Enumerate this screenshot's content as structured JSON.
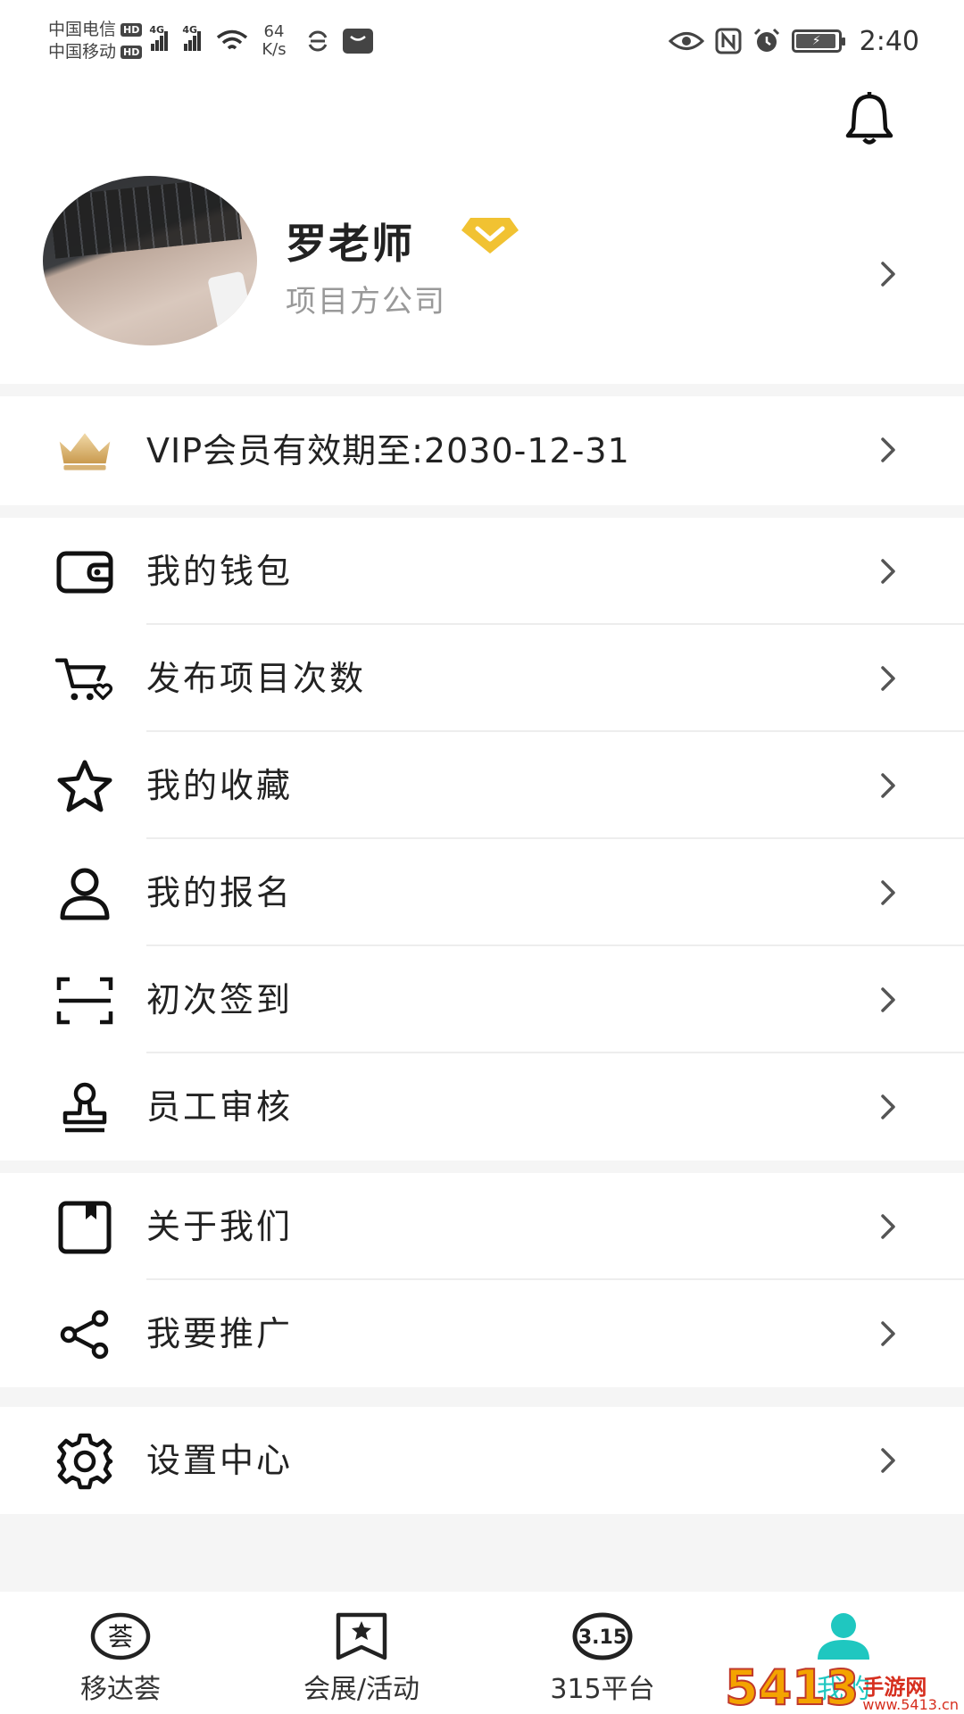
{
  "status_bar": {
    "carrier_1": "中国电信",
    "carrier_2": "中国移动",
    "hd_label": "HD",
    "network_type": "4G",
    "speed_value": "64",
    "speed_unit": "K/s",
    "time": "2:40",
    "icons": [
      "signal-icon",
      "wifi-icon",
      "sync-icon",
      "message-icon",
      "eye-icon",
      "nfc-icon",
      "alarm-icon",
      "battery-icon"
    ]
  },
  "profile": {
    "name": "罗老师",
    "company": "项目方公司",
    "badge_color": "#f1c232"
  },
  "vip": {
    "label": "VIP会员有效期至:2030-12-31"
  },
  "menu_group_1": [
    {
      "label": "我的钱包",
      "icon": "wallet-icon"
    },
    {
      "label": "发布项目次数",
      "icon": "cart-icon"
    },
    {
      "label": "我的收藏",
      "icon": "star-icon"
    },
    {
      "label": "我的报名",
      "icon": "person-icon"
    },
    {
      "label": "初次签到",
      "icon": "scan-icon"
    },
    {
      "label": "员工审核",
      "icon": "stamp-icon"
    }
  ],
  "menu_group_2": [
    {
      "label": "关于我们",
      "icon": "about-icon"
    },
    {
      "label": "我要推广",
      "icon": "share-icon"
    }
  ],
  "menu_group_3": [
    {
      "label": "设置中心",
      "icon": "gear-icon"
    }
  ],
  "tabbar": {
    "tabs": [
      {
        "label": "移达荟",
        "icon": "home-logo-icon"
      },
      {
        "label": "会展/活动",
        "icon": "bookmark-star-icon"
      },
      {
        "label": "315平台",
        "icon": "315-icon",
        "icon_text": "3.15"
      },
      {
        "label": "我的",
        "icon": "user-icon",
        "active": true
      }
    ],
    "home_icon_text": "荟",
    "active_color": "#1fc7c0"
  },
  "watermark": {
    "num": "5413",
    "site": "手游网",
    "url": "www.5413.cn"
  }
}
